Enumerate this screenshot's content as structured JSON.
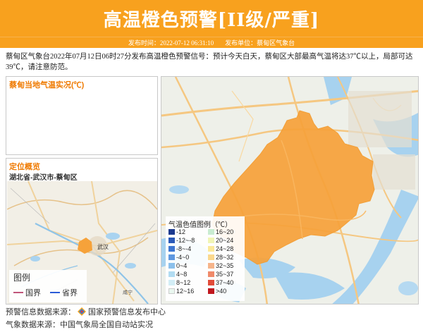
{
  "header": {
    "title": "高温橙色预警[II级/严重]",
    "publish_time_label": "发布时间：2022-07-12 06:31:10",
    "publisher_label": "发布单位：蔡甸区气象台",
    "color": "#f8a11e"
  },
  "description": "蔡甸区气象台2022年07月12日06时27分发布高温橙色预警信号：预计今天白天，蔡甸区大部最高气温将达37℃以上，局部可达39℃，请注意防范。",
  "temp_panel": {
    "title": "蔡甸当地气温实况(℃)"
  },
  "location_panel": {
    "title": "定位概览",
    "region": "湖北省-武汉市-蔡甸区",
    "map_labels": [
      "武汉",
      "咸宁"
    ],
    "legend_title": "图例",
    "legend_items": [
      {
        "label": "国界",
        "color": "#c0557a"
      },
      {
        "label": "省界",
        "color": "#2b5bd6"
      }
    ]
  },
  "temp_legend": {
    "title": "气温色值图例（℃）",
    "items": [
      {
        "label": "-12",
        "color": "#1b3a8f"
      },
      {
        "label": "-12~-8",
        "color": "#2a59b8"
      },
      {
        "label": "-8~-4",
        "color": "#3d76d1"
      },
      {
        "label": "-4~0",
        "color": "#5f98e0"
      },
      {
        "label": "0~4",
        "color": "#8cc0ec"
      },
      {
        "label": "4~8",
        "color": "#b2dcf2"
      },
      {
        "label": "8~12",
        "color": "#d3eef6"
      },
      {
        "label": "12~16",
        "color": "#e9f7ef"
      },
      {
        "label": "16~20",
        "color": "#c9ecd1"
      },
      {
        "label": "20~24",
        "color": "#f1f5b5"
      },
      {
        "label": "24~28",
        "color": "#fbe99a"
      },
      {
        "label": "28~32",
        "color": "#fbd88d"
      },
      {
        "label": "32~35",
        "color": "#f6b48a"
      },
      {
        "label": "35~37",
        "color": "#f08a6a"
      },
      {
        "label": "37~40",
        "color": "#e14b39"
      },
      {
        "label": ">40",
        "color": "#c0171e"
      }
    ]
  },
  "sources": {
    "warning_source": "预警信息数据来源：",
    "warning_org": "国家预警信息发布中心",
    "weather_source": "气象数据来源：中国气象局全国自动站实况"
  }
}
